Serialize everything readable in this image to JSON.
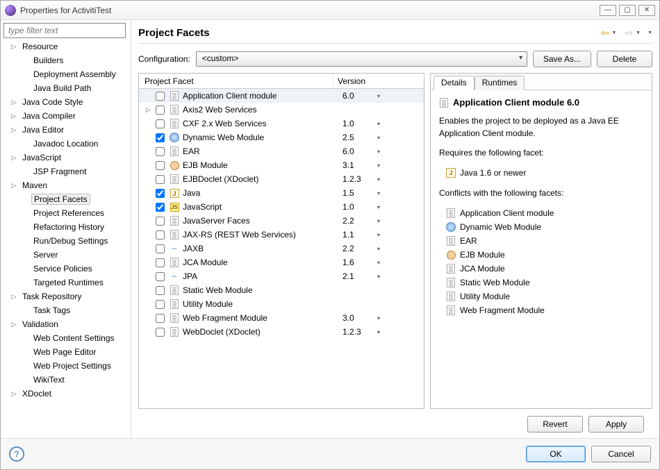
{
  "window": {
    "title": "Properties for ActivitiTest"
  },
  "sidebar": {
    "filter_placeholder": "type filter text",
    "items": [
      {
        "label": "Resource",
        "expandable": true,
        "indent": 0
      },
      {
        "label": "Builders",
        "expandable": false,
        "indent": 1
      },
      {
        "label": "Deployment Assembly",
        "expandable": false,
        "indent": 1
      },
      {
        "label": "Java Build Path",
        "expandable": false,
        "indent": 1
      },
      {
        "label": "Java Code Style",
        "expandable": true,
        "indent": 0
      },
      {
        "label": "Java Compiler",
        "expandable": true,
        "indent": 0
      },
      {
        "label": "Java Editor",
        "expandable": true,
        "indent": 0
      },
      {
        "label": "Javadoc Location",
        "expandable": false,
        "indent": 1
      },
      {
        "label": "JavaScript",
        "expandable": true,
        "indent": 0
      },
      {
        "label": "JSP Fragment",
        "expandable": false,
        "indent": 1
      },
      {
        "label": "Maven",
        "expandable": true,
        "indent": 0
      },
      {
        "label": "Project Facets",
        "expandable": false,
        "indent": 1,
        "selected": true
      },
      {
        "label": "Project References",
        "expandable": false,
        "indent": 1
      },
      {
        "label": "Refactoring History",
        "expandable": false,
        "indent": 1
      },
      {
        "label": "Run/Debug Settings",
        "expandable": false,
        "indent": 1
      },
      {
        "label": "Server",
        "expandable": false,
        "indent": 1
      },
      {
        "label": "Service Policies",
        "expandable": false,
        "indent": 1
      },
      {
        "label": "Targeted Runtimes",
        "expandable": false,
        "indent": 1
      },
      {
        "label": "Task Repository",
        "expandable": true,
        "indent": 0
      },
      {
        "label": "Task Tags",
        "expandable": false,
        "indent": 1
      },
      {
        "label": "Validation",
        "expandable": true,
        "indent": 0
      },
      {
        "label": "Web Content Settings",
        "expandable": false,
        "indent": 1
      },
      {
        "label": "Web Page Editor",
        "expandable": false,
        "indent": 1
      },
      {
        "label": "Web Project Settings",
        "expandable": false,
        "indent": 1
      },
      {
        "label": "WikiText",
        "expandable": false,
        "indent": 1
      },
      {
        "label": "XDoclet",
        "expandable": true,
        "indent": 0
      }
    ]
  },
  "heading": "Project Facets",
  "configuration": {
    "label": "Configuration:",
    "value": "<custom>",
    "save_as": "Save As...",
    "delete": "Delete"
  },
  "facet_table": {
    "col_facet": "Project Facet",
    "col_version": "Version",
    "rows": [
      {
        "name": "Application Client module",
        "version": "6.0",
        "checked": false,
        "twisty": "",
        "selected": true,
        "icon": "file"
      },
      {
        "name": "Axis2 Web Services",
        "version": "",
        "checked": false,
        "twisty": "▷",
        "icon": "file"
      },
      {
        "name": "CXF 2.x Web Services",
        "version": "1.0",
        "checked": false,
        "twisty": "",
        "icon": "file"
      },
      {
        "name": "Dynamic Web Module",
        "version": "2.5",
        "checked": true,
        "twisty": "",
        "icon": "globe"
      },
      {
        "name": "EAR",
        "version": "6.0",
        "checked": false,
        "twisty": "",
        "icon": "file"
      },
      {
        "name": "EJB Module",
        "version": "3.1",
        "checked": false,
        "twisty": "",
        "icon": "bean"
      },
      {
        "name": "EJBDoclet (XDoclet)",
        "version": "1.2.3",
        "checked": false,
        "twisty": "",
        "icon": "file"
      },
      {
        "name": "Java",
        "version": "1.5",
        "checked": true,
        "twisty": "",
        "icon": "java"
      },
      {
        "name": "JavaScript",
        "version": "1.0",
        "checked": true,
        "twisty": "",
        "icon": "js"
      },
      {
        "name": "JavaServer Faces",
        "version": "2.2",
        "checked": false,
        "twisty": "",
        "icon": "file"
      },
      {
        "name": "JAX-RS (REST Web Services)",
        "version": "1.1",
        "checked": false,
        "twisty": "",
        "icon": "file"
      },
      {
        "name": "JAXB",
        "version": "2.2",
        "checked": false,
        "twisty": "",
        "icon": "jaxb"
      },
      {
        "name": "JCA Module",
        "version": "1.6",
        "checked": false,
        "twisty": "",
        "icon": "file"
      },
      {
        "name": "JPA",
        "version": "2.1",
        "checked": false,
        "twisty": "",
        "icon": "jpa"
      },
      {
        "name": "Static Web Module",
        "version": "",
        "checked": false,
        "twisty": "",
        "icon": "file"
      },
      {
        "name": "Utility Module",
        "version": "",
        "checked": false,
        "twisty": "",
        "icon": "file"
      },
      {
        "name": "Web Fragment Module",
        "version": "3.0",
        "checked": false,
        "twisty": "",
        "icon": "file"
      },
      {
        "name": "WebDoclet (XDoclet)",
        "version": "1.2.3",
        "checked": false,
        "twisty": "",
        "icon": "file"
      }
    ]
  },
  "details": {
    "tab_details": "Details",
    "tab_runtimes": "Runtimes",
    "title": "Application Client module 6.0",
    "description": "Enables the project to be deployed as a Java EE Application Client module.",
    "requires_label": "Requires the following facet:",
    "requires_item": "Java 1.6 or newer",
    "conflicts_label": "Conflicts with the following facets:",
    "conflicts": [
      "Application Client module",
      "Dynamic Web Module",
      "EAR",
      "EJB Module",
      "JCA Module",
      "Static Web Module",
      "Utility Module",
      "Web Fragment Module"
    ]
  },
  "buttons": {
    "revert": "Revert",
    "apply": "Apply",
    "ok": "OK",
    "cancel": "Cancel"
  }
}
